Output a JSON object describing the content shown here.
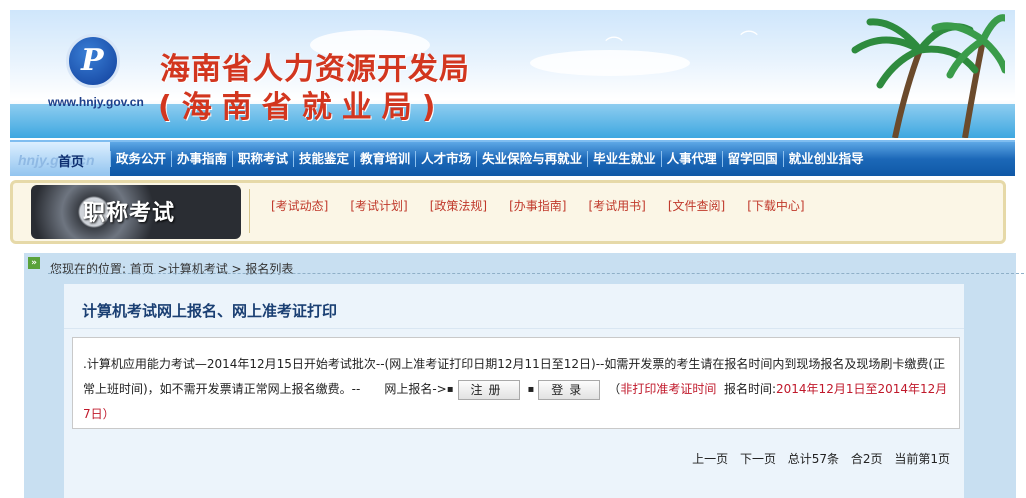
{
  "header": {
    "org_title": "海南省人力资源开发局",
    "org_subtitle": "(海南省就业局)",
    "site_url": "www.hnjy.gov.cn",
    "logo_watermark": "hnjy.gov.cn"
  },
  "nav": {
    "home": "首页",
    "items": [
      "政务公开",
      "办事指南",
      "职称考试",
      "技能鉴定",
      "教育培训",
      "人才市场",
      "失业保险与再就业",
      "毕业生就业",
      "人事代理",
      "留学回国",
      "就业创业指导"
    ]
  },
  "section": {
    "badge": "职称考试",
    "links": [
      "[考试动态]",
      "[考试计划]",
      "[政策法规]",
      "[办事指南]",
      "[考试用书]",
      "[文件查阅]",
      "[下载中心]"
    ]
  },
  "breadcrumb": {
    "text": "您现在的位置: 首页 >计算机考试 > 报名列表"
  },
  "panel": {
    "title": "计算机考试网上报名、网上准考证打印",
    "notice_text": ".计算机应用能力考试—2014年12月15日开始考试批次--(网上准考证打印日期12月11日至12日)--如需开发票的考生请在报名时间内到现场报名及现场刷卡缴费(正常上班时间)，如不需开发票请正常网上报名缴费。--　　网上报名->",
    "register_button": "注册",
    "login_button": "登录",
    "paren_open": "（",
    "no_print_label": "非打印准考证时间",
    "period_label": "报名时间:",
    "period_value": "2014年12月1日至2014年12月7日）"
  },
  "pager": {
    "prev": "上一页",
    "next": "下一页",
    "total": "总计57条",
    "pages": "合2页",
    "current": "当前第1页"
  },
  "colors": {
    "nav_blue": "#1c68b8",
    "title_red": "#d2361f",
    "link_red": "#c0392b",
    "panel_bg": "#ecf4fb"
  }
}
